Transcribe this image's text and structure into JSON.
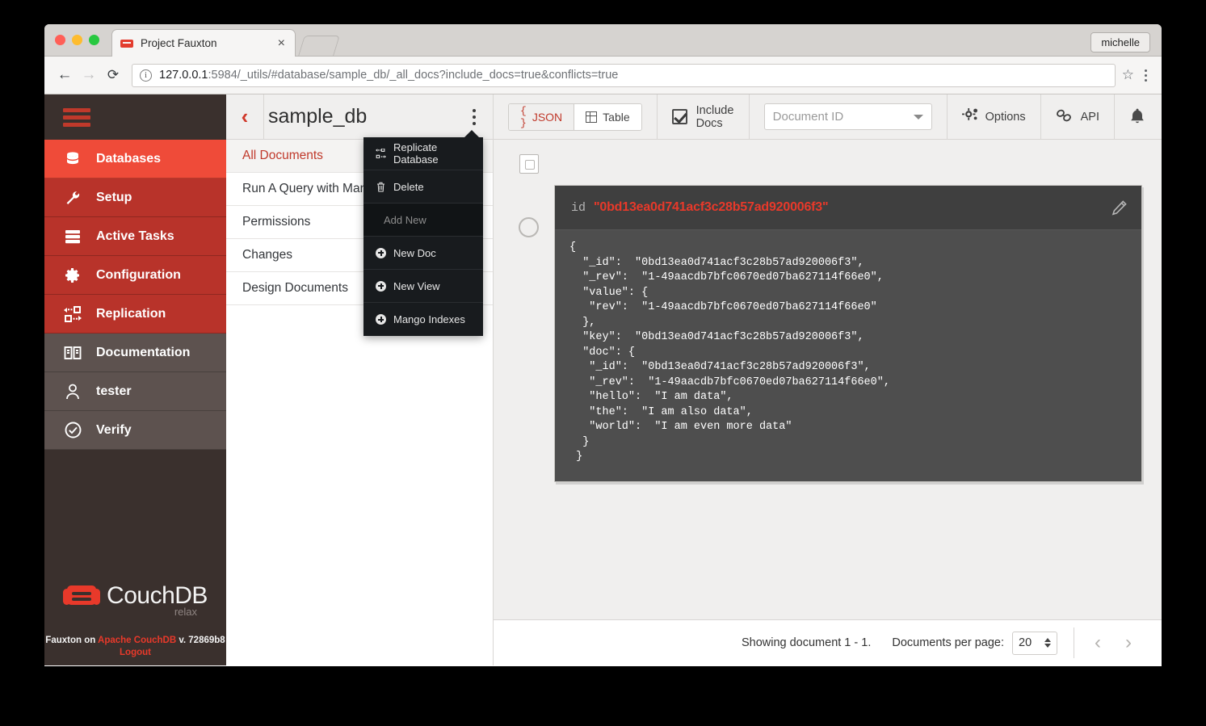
{
  "browser": {
    "tab_title": "Project Fauxton",
    "tab_close": "×",
    "url_host": "127.0.0.1",
    "url_rest": ":5984/_utils/#database/sample_db/_all_docs?include_docs=true&conflicts=true",
    "user_chip": "michelle",
    "back_icon": "←",
    "forward_icon": "→",
    "reload_icon": "⟳",
    "star_icon": "☆",
    "info_icon": "i"
  },
  "sidebar": {
    "items": [
      {
        "label": "Databases",
        "icon": "database-icon",
        "style": "active"
      },
      {
        "label": "Setup",
        "icon": "wrench-icon",
        "style": "red"
      },
      {
        "label": "Active Tasks",
        "icon": "tasks-icon",
        "style": "red"
      },
      {
        "label": "Configuration",
        "icon": "gear-icon",
        "style": "red"
      },
      {
        "label": "Replication",
        "icon": "replication-icon",
        "style": "red"
      },
      {
        "label": "Documentation",
        "icon": "book-icon",
        "style": "grey"
      },
      {
        "label": "tester",
        "icon": "user-icon",
        "style": "grey"
      },
      {
        "label": "Verify",
        "icon": "check-circle-icon",
        "style": "grey"
      }
    ],
    "footer": {
      "logo_text": "CouchDB",
      "logo_sub": "relax",
      "credit_prefix": "Fauxton on ",
      "credit_link": "Apache CouchDB",
      "credit_suffix": " v. 72869b8",
      "logout": "Logout"
    }
  },
  "dbpanel": {
    "db_name": "sample_db",
    "back_icon": "‹",
    "rows": [
      {
        "label": "All Documents",
        "selected": true
      },
      {
        "label": "Run A Query with Mango",
        "selected": false
      },
      {
        "label": "Permissions",
        "selected": false
      },
      {
        "label": "Changes",
        "selected": false
      },
      {
        "label": "Design Documents",
        "selected": false
      }
    ],
    "dropdown": [
      {
        "label": "Replicate Database",
        "icon": "replicate-icon",
        "type": "item"
      },
      {
        "label": "Delete",
        "icon": "trash-icon",
        "type": "item"
      },
      {
        "label": "Add New",
        "icon": "",
        "type": "header"
      },
      {
        "label": "New Doc",
        "icon": "plus-icon",
        "type": "item"
      },
      {
        "label": "New View",
        "icon": "plus-icon",
        "type": "item"
      },
      {
        "label": "Mango Indexes",
        "icon": "plus-icon",
        "type": "item"
      }
    ]
  },
  "toolbar": {
    "json_label": "JSON",
    "json_braces": "{ }",
    "table_label": "Table",
    "include_docs_label": "Include Docs",
    "document_id_placeholder": "Document ID",
    "options_label": "Options",
    "api_label": "API",
    "bell_icon": "bell-icon"
  },
  "document": {
    "id_label": "id",
    "id_value": "\"0bd13ea0d741acf3c28b57ad920006f3\"",
    "json_lines": "{\n  \"_id\":  \"0bd13ea0d741acf3c28b57ad920006f3\",\n  \"_rev\":  \"1-49aacdb7bfc0670ed07ba627114f66e0\",\n  \"value\": {\n   \"rev\":  \"1-49aacdb7bfc0670ed07ba627114f66e0\"\n  },\n  \"key\":  \"0bd13ea0d741acf3c28b57ad920006f3\",\n  \"doc\": {\n   \"_id\":  \"0bd13ea0d741acf3c28b57ad920006f3\",\n   \"_rev\":  \"1-49aacdb7bfc0670ed07ba627114f66e0\",\n   \"hello\":  \"I am data\",\n   \"the\":  \"I am also data\",\n   \"world\":  \"I am even more data\"\n  }\n }"
  },
  "pager": {
    "showing_text": "Showing document 1 - 1.",
    "per_page_label": "Documents per page:",
    "per_page_value": "20",
    "prev_icon": "‹",
    "next_icon": "›"
  },
  "colors": {
    "brand_red": "#e8392a",
    "active_red": "#ef4b39",
    "nav_red": "#b8332a",
    "nav_grey": "#5d524f",
    "sidebar_bg": "#3a302d",
    "card_bg": "#4e4e4e",
    "card_head_bg": "#3f3f3f"
  }
}
